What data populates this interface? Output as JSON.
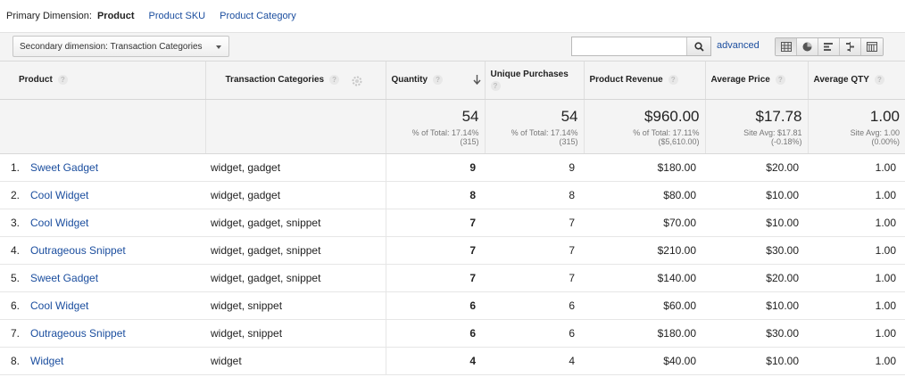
{
  "primary": {
    "label": "Primary Dimension:",
    "active": "Product",
    "links": [
      "Product SKU",
      "Product Category"
    ]
  },
  "toolbar": {
    "secondary_dimension": "Secondary dimension: Transaction Categories",
    "search_value": "",
    "advanced": "advanced",
    "view_icons": [
      "table-view-icon",
      "pie-chart-view-icon",
      "performance-view-icon",
      "comparison-view-icon",
      "pivot-view-icon"
    ]
  },
  "columns": {
    "product": "Product",
    "categories": "Transaction Categories",
    "quantity": "Quantity",
    "unique_purchases": "Unique Purchases",
    "revenue": "Product Revenue",
    "avg_price": "Average Price",
    "avg_qty": "Average QTY"
  },
  "totals": {
    "quantity": {
      "value": "54",
      "line1": "% of Total: 17.14%",
      "line2": "(315)"
    },
    "unique_purchases": {
      "value": "54",
      "line1": "% of Total: 17.14%",
      "line2": "(315)"
    },
    "revenue": {
      "value": "$960.00",
      "line1": "% of Total: 17.11%",
      "line2": "($5,610.00)"
    },
    "avg_price": {
      "value": "$17.78",
      "line1": "Site Avg: $17.81",
      "line2": "(-0.18%)"
    },
    "avg_qty": {
      "value": "1.00",
      "line1": "Site Avg: 1.00",
      "line2": "(0.00%)"
    }
  },
  "rows": [
    {
      "num": "1.",
      "product": "Sweet Gadget",
      "categories": "widget, gadget",
      "quantity": "9",
      "unique": "9",
      "revenue": "$180.00",
      "avg_price": "$20.00",
      "avg_qty": "1.00"
    },
    {
      "num": "2.",
      "product": "Cool Widget",
      "categories": "widget, gadget",
      "quantity": "8",
      "unique": "8",
      "revenue": "$80.00",
      "avg_price": "$10.00",
      "avg_qty": "1.00"
    },
    {
      "num": "3.",
      "product": "Cool Widget",
      "categories": "widget, gadget, snippet",
      "quantity": "7",
      "unique": "7",
      "revenue": "$70.00",
      "avg_price": "$10.00",
      "avg_qty": "1.00"
    },
    {
      "num": "4.",
      "product": "Outrageous Snippet",
      "categories": "widget, gadget, snippet",
      "quantity": "7",
      "unique": "7",
      "revenue": "$210.00",
      "avg_price": "$30.00",
      "avg_qty": "1.00"
    },
    {
      "num": "5.",
      "product": "Sweet Gadget",
      "categories": "widget, gadget, snippet",
      "quantity": "7",
      "unique": "7",
      "revenue": "$140.00",
      "avg_price": "$20.00",
      "avg_qty": "1.00"
    },
    {
      "num": "6.",
      "product": "Cool Widget",
      "categories": "widget, snippet",
      "quantity": "6",
      "unique": "6",
      "revenue": "$60.00",
      "avg_price": "$10.00",
      "avg_qty": "1.00"
    },
    {
      "num": "7.",
      "product": "Outrageous Snippet",
      "categories": "widget, snippet",
      "quantity": "6",
      "unique": "6",
      "revenue": "$180.00",
      "avg_price": "$30.00",
      "avg_qty": "1.00"
    },
    {
      "num": "8.",
      "product": "Widget",
      "categories": "widget",
      "quantity": "4",
      "unique": "4",
      "revenue": "$40.00",
      "avg_price": "$10.00",
      "avg_qty": "1.00"
    }
  ]
}
